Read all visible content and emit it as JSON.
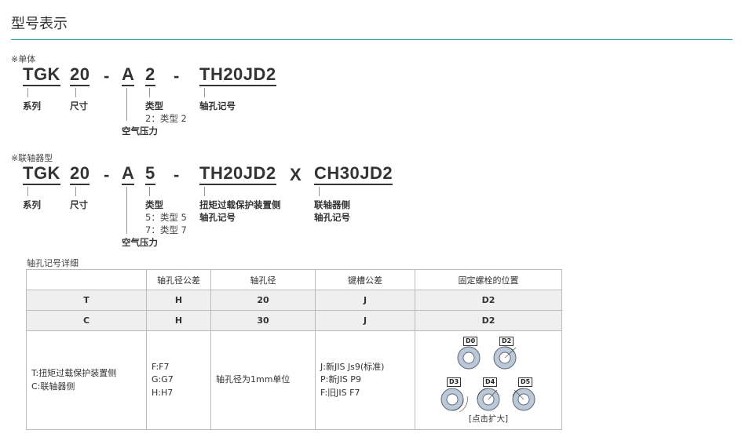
{
  "title": "型号表示",
  "single": {
    "note": "※单体",
    "codes": [
      "TGK",
      "20",
      "-",
      "A",
      "2",
      "-",
      "TH20JD2"
    ],
    "labels": {
      "series": "系列",
      "size": "尺寸",
      "type": "类型",
      "type_opt": "2：类型 2",
      "air": "空气压力",
      "shaft": "轴孔记号"
    }
  },
  "coupling": {
    "note": "※联轴器型",
    "codes": [
      "TGK",
      "20",
      "-",
      "A",
      "5",
      "-",
      "TH20JD2",
      "X",
      "CH30JD2"
    ],
    "labels": {
      "series": "系列",
      "size": "尺寸",
      "type": "类型",
      "type_opt1": "5：类型 5",
      "type_opt2": "7：类型 7",
      "air": "空气压力",
      "protect": "扭矩过载保护装置侧",
      "protect_shaft": "轴孔记号",
      "coupling": "联轴器侧",
      "coupling_shaft": "轴孔记号"
    }
  },
  "table": {
    "caption": "轴孔记号详细",
    "headers": [
      "",
      "轴孔径公差",
      "轴孔径",
      "键槽公差",
      "固定螺栓的位置"
    ],
    "rows": [
      [
        "T",
        "H",
        "20",
        "J",
        "D2"
      ],
      [
        "C",
        "H",
        "30",
        "J",
        "D2"
      ]
    ],
    "detail": {
      "col1": [
        "T:扭矩过载保护装置侧",
        "C:联轴器侧"
      ],
      "col2": [
        "F:F7",
        "G:G7",
        "H:H7"
      ],
      "col3": "轴孔径为1mm单位",
      "col4": [
        "J:新JIS Js9(标准)",
        "P:新JIS P9",
        "F:旧JIS F7"
      ],
      "diagram_labels": [
        "D0",
        "D2",
        "D3",
        "D4",
        "D5"
      ],
      "enlarge": "[点击扩大]"
    }
  }
}
